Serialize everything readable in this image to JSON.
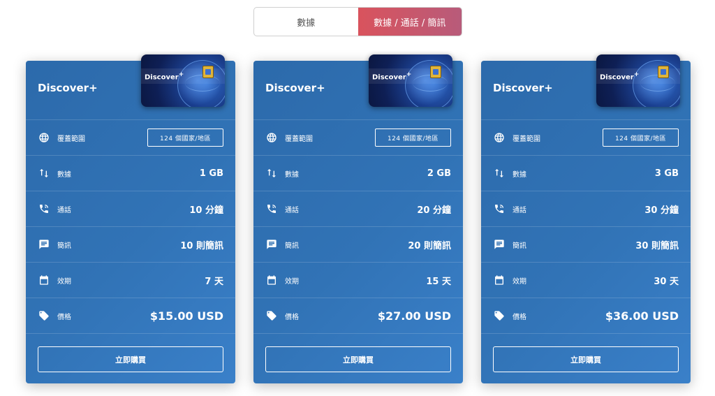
{
  "toggle": {
    "options": [
      "數據",
      "數據 / 通話 / 簡訊"
    ],
    "active_index": 1
  },
  "labels": {
    "coverage": "覆蓋範圍",
    "data": "數據",
    "calls": "通話",
    "sms": "簡訊",
    "validity": "效期",
    "price": "價格",
    "buy": "立即購買"
  },
  "sim": {
    "brand": "Discover",
    "sup": "+"
  },
  "colors": {
    "card_gradient_start": "#2c6aab",
    "card_gradient_end": "#3a80c9",
    "toggle_active_start": "#d9535d",
    "toggle_active_end": "#b85b7a"
  },
  "plans": [
    {
      "name": "Discover+",
      "coverage": "124 個國家/地區",
      "data": "1 GB",
      "calls": "10 分鐘",
      "sms": "10 則簡訊",
      "validity": "7 天",
      "price": "$15.00 USD"
    },
    {
      "name": "Discover+",
      "coverage": "124 個國家/地區",
      "data": "2 GB",
      "calls": "20 分鐘",
      "sms": "20 則簡訊",
      "validity": "15 天",
      "price": "$27.00 USD"
    },
    {
      "name": "Discover+",
      "coverage": "124 個國家/地區",
      "data": "3 GB",
      "calls": "30 分鐘",
      "sms": "30 則簡訊",
      "validity": "30 天",
      "price": "$36.00 USD"
    }
  ]
}
